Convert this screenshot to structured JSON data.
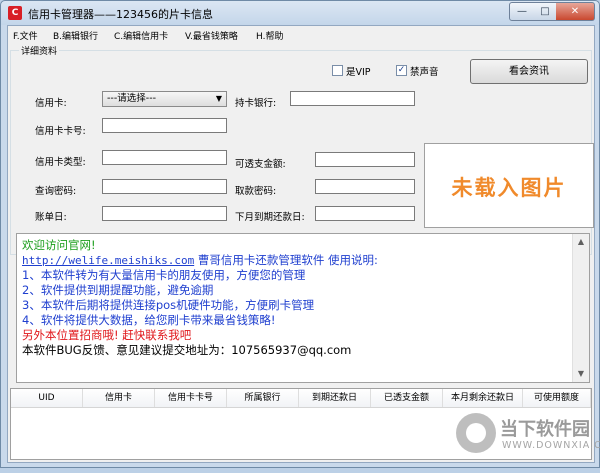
{
  "window": {
    "title": "信用卡管理器——123456的片卡信息",
    "icon_text": "C",
    "min_glyph": "—",
    "max_glyph": "□",
    "close_glyph": "✕"
  },
  "menu": [
    {
      "label": "F.文件"
    },
    {
      "label": "B.编辑银行"
    },
    {
      "label": "C.编辑信用卡"
    },
    {
      "label": "V.最省钱策略"
    },
    {
      "label": "H.帮助"
    }
  ],
  "details": {
    "group_title": "详细资料",
    "vip_label": "是VIP",
    "vip_checked": false,
    "mute_label": "禁声音",
    "mute_checked": true,
    "news_button": "看会资讯",
    "card_label": "信用卡:",
    "card_select": "---请选择---",
    "bank_label": "持卡银行:",
    "card_number_label": "信用卡卡号:",
    "card_type_label": "信用卡类型:",
    "overdraft_label": "可透支金额:",
    "query_pwd_label": "查询密码:",
    "withdraw_pwd_label": "取款密码:",
    "bill_day_label": "账单日:",
    "next_due_label": "下月到期还款日:",
    "image_placeholder": "未载入图片"
  },
  "info": {
    "lines": [
      {
        "text": "欢迎访问官网!",
        "color": "#1a9e1a"
      },
      {
        "link": "http://welife.meishiks.com",
        "text": " 曹哥信用卡还款管理软件 使用说明:",
        "color": "#1f3fcf"
      },
      {
        "text": "1、本软件转为有大量信用卡的朋友使用，方便您的管理",
        "color": "#1f3fcf"
      },
      {
        "text": "2、软件提供到期提醒功能，避免逾期",
        "color": "#1f3fcf"
      },
      {
        "text": "3、本软件后期将提供连接pos机硬件功能，方便刷卡管理",
        "color": "#1f3fcf"
      },
      {
        "text": "4、软件将提供大数据，给您刷卡带来最省钱策略!",
        "color": "#1f3fcf"
      },
      {
        "text": "另外本位置招商哦! 赶快联系我吧",
        "color": "#e0161a"
      },
      {
        "text": "本软件BUG反馈、意见建议提交地址为：107565937@qq.com",
        "color": "#000000"
      }
    ]
  },
  "table": {
    "columns": [
      "UID",
      "信用卡",
      "信用卡卡号",
      "所属银行",
      "到期还款日",
      "已透支金额",
      "本月剩余还款日",
      "可使用额度"
    ]
  },
  "watermark": {
    "name": "当下软件园",
    "url": "WWW.DOWNXIA.COM"
  },
  "colors": {
    "accent": "#f08a2b",
    "link": "#1f3fcf"
  }
}
